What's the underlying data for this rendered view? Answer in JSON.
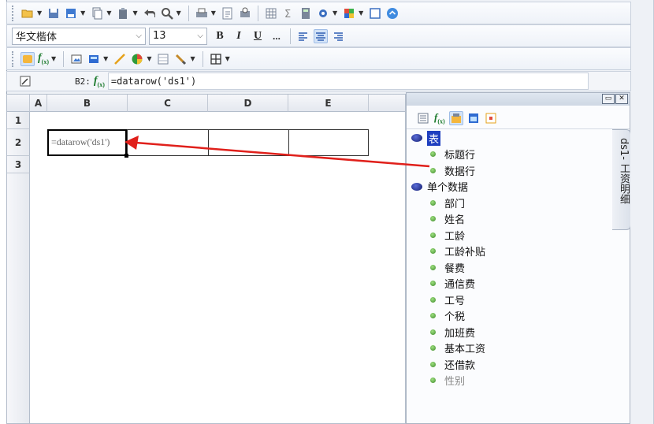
{
  "toolbar2": {
    "font_family": "华文楷体",
    "font_size": "13",
    "bold": "B",
    "italic": "I",
    "underline": "U",
    "more": "..."
  },
  "toolbar3": {
    "fx_label": "f(x)"
  },
  "formula_bar": {
    "cell_ref": "B2:",
    "fx_label": "f(x)",
    "value": "=datarow('ds1')"
  },
  "sheet": {
    "columns": [
      "A",
      "B",
      "C",
      "D",
      "E"
    ],
    "rows": [
      "1",
      "2",
      "3"
    ],
    "cell_b2": "=datarow('ds1')"
  },
  "panel": {
    "tab_label": "ds1- 工资明细",
    "root_table": "表",
    "table_children": [
      "标题行",
      "数据行"
    ],
    "root_single": "单个数据",
    "fields": [
      "部门",
      "姓名",
      "工龄",
      "工龄补贴",
      "餐费",
      "通信费",
      "工号",
      "个税",
      "加班费",
      "基本工资",
      "还借款",
      "性别"
    ]
  },
  "colors": {
    "arrow": "#e0201b",
    "selection_bg": "#1f3fbf"
  }
}
